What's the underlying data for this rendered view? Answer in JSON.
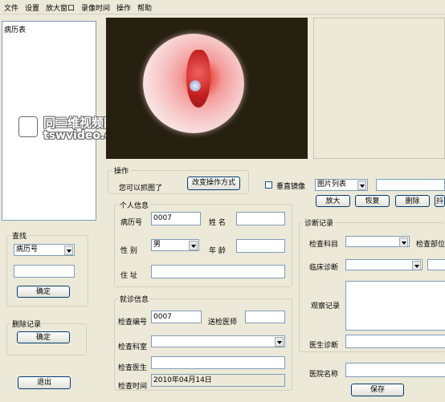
{
  "menu": [
    "文件",
    "设置",
    "放大窗口",
    "录像时间",
    "操作",
    "帮助"
  ],
  "case_list": {
    "title": "病历表"
  },
  "watermark": {
    "line1": "同三维视频网",
    "line2": "tswvideo.com"
  },
  "operation": {
    "group_title": "操作",
    "hint": "您可以抓图了",
    "change_mode_button": "改变操作方式"
  },
  "image_tools": {
    "mirror_label": "垂直镜像",
    "mirror_checked": false,
    "view_select": "图片列表",
    "zoom_in": "放大",
    "restore": "恢复",
    "delete": "删除",
    "partial_button": "抖"
  },
  "search": {
    "group_title": "查找",
    "field_select": "病历号",
    "query_value": "",
    "ok_button": "确定"
  },
  "delete_record": {
    "group_title": "删除记录",
    "ok_button": "确定"
  },
  "exit_button": "退出",
  "personal": {
    "group_title": "个人信息",
    "case_no_label": "病历号",
    "case_no": "0007",
    "name_label": "姓 名",
    "name": "",
    "sex_label": "性 别",
    "sex": "男",
    "age_label": "年 龄",
    "age": "",
    "address_label": "住 址",
    "address": ""
  },
  "visit": {
    "group_title": "就诊信息",
    "exam_no_label": "检查编号",
    "exam_no": "0007",
    "referring_doctor_label": "送检医师",
    "referring_doctor": "",
    "dept_label": "检查科室",
    "dept": "",
    "doctor_label": "检查医生",
    "doctor": "",
    "time_label": "检查时间",
    "time": "2010年04月14日"
  },
  "diagnosis": {
    "group_title": "诊断记录",
    "subject_label": "检查科目",
    "subject": "",
    "site_label": "检查部位",
    "clinical_label": "临床诊断",
    "clinical": "",
    "observation_label": "观察记录",
    "observation": "",
    "doctor_dx_label": "医生诊断",
    "doctor_dx": "",
    "hospital_label": "医院名称",
    "hospital": "",
    "save_button": "保存"
  }
}
